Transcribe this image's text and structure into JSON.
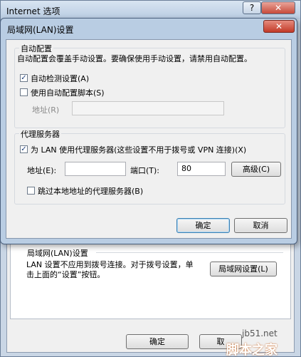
{
  "outer": {
    "title": "Internet 选项",
    "help_label": "?",
    "close_label": "✕",
    "lan_group_title": "局域网(LAN)设置",
    "lan_desc": "LAN 设置不应用到拨号连接。对于拨号设置，单击上面的“设置”按钮。",
    "lan_settings_button": "局域网设置(L)",
    "ok_label": "确定",
    "cancel_label": "取"
  },
  "dialog": {
    "title": "局域网(LAN)设置",
    "close_label": "✕",
    "auto_group": {
      "label": "自动配置",
      "description": "自动配置会覆盖手动设置。要确保使用手动设置，请禁用自动配置。",
      "auto_detect": {
        "label": "自动检测设置(A)",
        "checked": true
      },
      "use_script": {
        "label": "使用自动配置脚本(S)",
        "checked": false
      },
      "address_label": "地址(R)",
      "address_value": ""
    },
    "proxy_group": {
      "label": "代理服务器",
      "use_proxy": {
        "label": "为 LAN 使用代理服务器(这些设置不用于拨号或 VPN 连接)(X)",
        "checked": true
      },
      "address_label": "地址(E):",
      "address_value": "",
      "port_label": "端口(T):",
      "port_value": "80",
      "advanced_label": "高级(C)",
      "bypass_local": {
        "label": "跳过本地地址的代理服务器(B)",
        "checked": false
      }
    },
    "ok_label": "确定",
    "cancel_label": "取消"
  },
  "watermark": {
    "site": "jb51.net",
    "brand": "脚本之家"
  },
  "check_glyph": "✓"
}
